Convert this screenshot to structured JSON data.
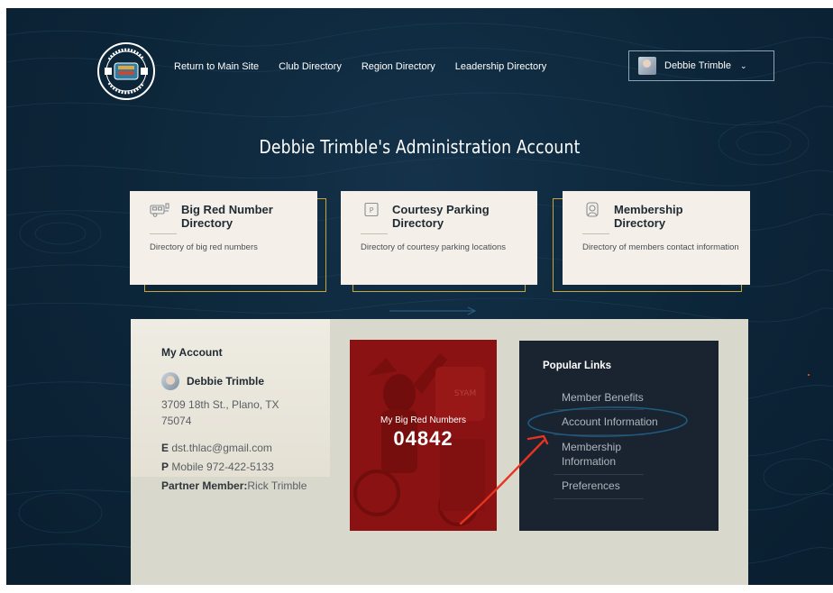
{
  "nav": {
    "logo_text": "BIRTHERN CLUB INTERNATIONAL",
    "links": [
      "Return to Main Site",
      "Club Directory",
      "Region Directory",
      "Leadership Directory"
    ],
    "user_name": "Debbie Trimble",
    "chevron": "⌄"
  },
  "page_title": "Debbie Trimble's Administration Account",
  "cards": [
    {
      "icon": "trailer-icon",
      "title_line1": "Big Red Number",
      "title_line2": "Directory",
      "description": "Directory of big red numbers"
    },
    {
      "icon": "parking-icon",
      "title_line1": "Courtesy Parking",
      "title_line2": "Directory",
      "description": "Directory of courtesy parking locations"
    },
    {
      "icon": "member-icon",
      "title_line1": "Membership",
      "title_line2": "Directory",
      "description": "Directory of members contact information"
    }
  ],
  "account": {
    "heading": "My Account",
    "name": "Debbie Trimble",
    "address": "3709 18th St., Plano, TX 75074",
    "email_label": "E",
    "email": "dst.thlac@gmail.com",
    "phone_label": "P",
    "phone": "Mobile 972-422-5133",
    "partner_label": "Partner Member:",
    "partner_name": "Rick Trimble"
  },
  "big_red": {
    "label": "My Big Red Numbers",
    "number": "04842"
  },
  "popular_links": {
    "heading": "Popular Links",
    "items": [
      "Member Benefits",
      "Account Information",
      "Membership Information",
      "Preferences"
    ]
  },
  "colors": {
    "background": "#0c2538",
    "card_border": "#c9a43a",
    "card_bg": "#f4efe8",
    "big_red": "#8e1313",
    "popular_bg": "#1a2430",
    "annotation_circle": "#1f5a80",
    "annotation_arrow": "#e8331f"
  }
}
